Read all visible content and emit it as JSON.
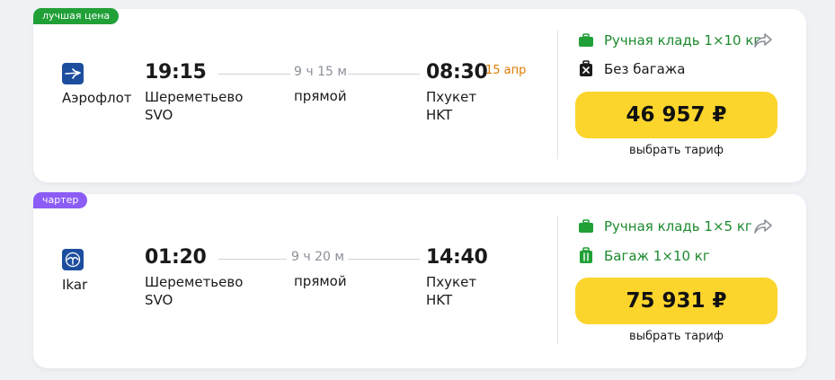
{
  "colors": {
    "best_badge": "#21a038",
    "charter_badge": "#8b5cf6",
    "price_button": "#fcd52c",
    "baggage_green": "#1d8a2e",
    "next_date": "#e07b00"
  },
  "flights": [
    {
      "badge": "лучшая цена",
      "airline": "Аэрофлот",
      "airline_logo": "aeroflot-logo",
      "depart_time": "19:15",
      "depart_airport": "Шереметьево",
      "depart_code": "SVO",
      "duration": "9 ч 15 м",
      "stops": "прямой",
      "arrive_time": "08:30",
      "arrive_next_date": "15 апр",
      "arrive_airport": "Пхукет",
      "arrive_code": "HKT",
      "hand_luggage": "Ручная кладь 1×10 кг",
      "baggage": "Без багажа",
      "baggage_included": false,
      "price": "46 957 ₽",
      "tariff_label": "выбрать тариф"
    },
    {
      "badge": "чартер",
      "airline": "Ikar",
      "airline_logo": "ikar-logo",
      "depart_time": "01:20",
      "depart_airport": "Шереметьево",
      "depart_code": "SVO",
      "duration": "9 ч 20 м",
      "stops": "прямой",
      "arrive_time": "14:40",
      "arrive_next_date": "",
      "arrive_airport": "Пхукет",
      "arrive_code": "HKT",
      "hand_luggage": "Ручная кладь 1×5 кг",
      "baggage": "Багаж 1×10 кг",
      "baggage_included": true,
      "price": "75 931 ₽",
      "tariff_label": "выбрать тариф"
    }
  ]
}
